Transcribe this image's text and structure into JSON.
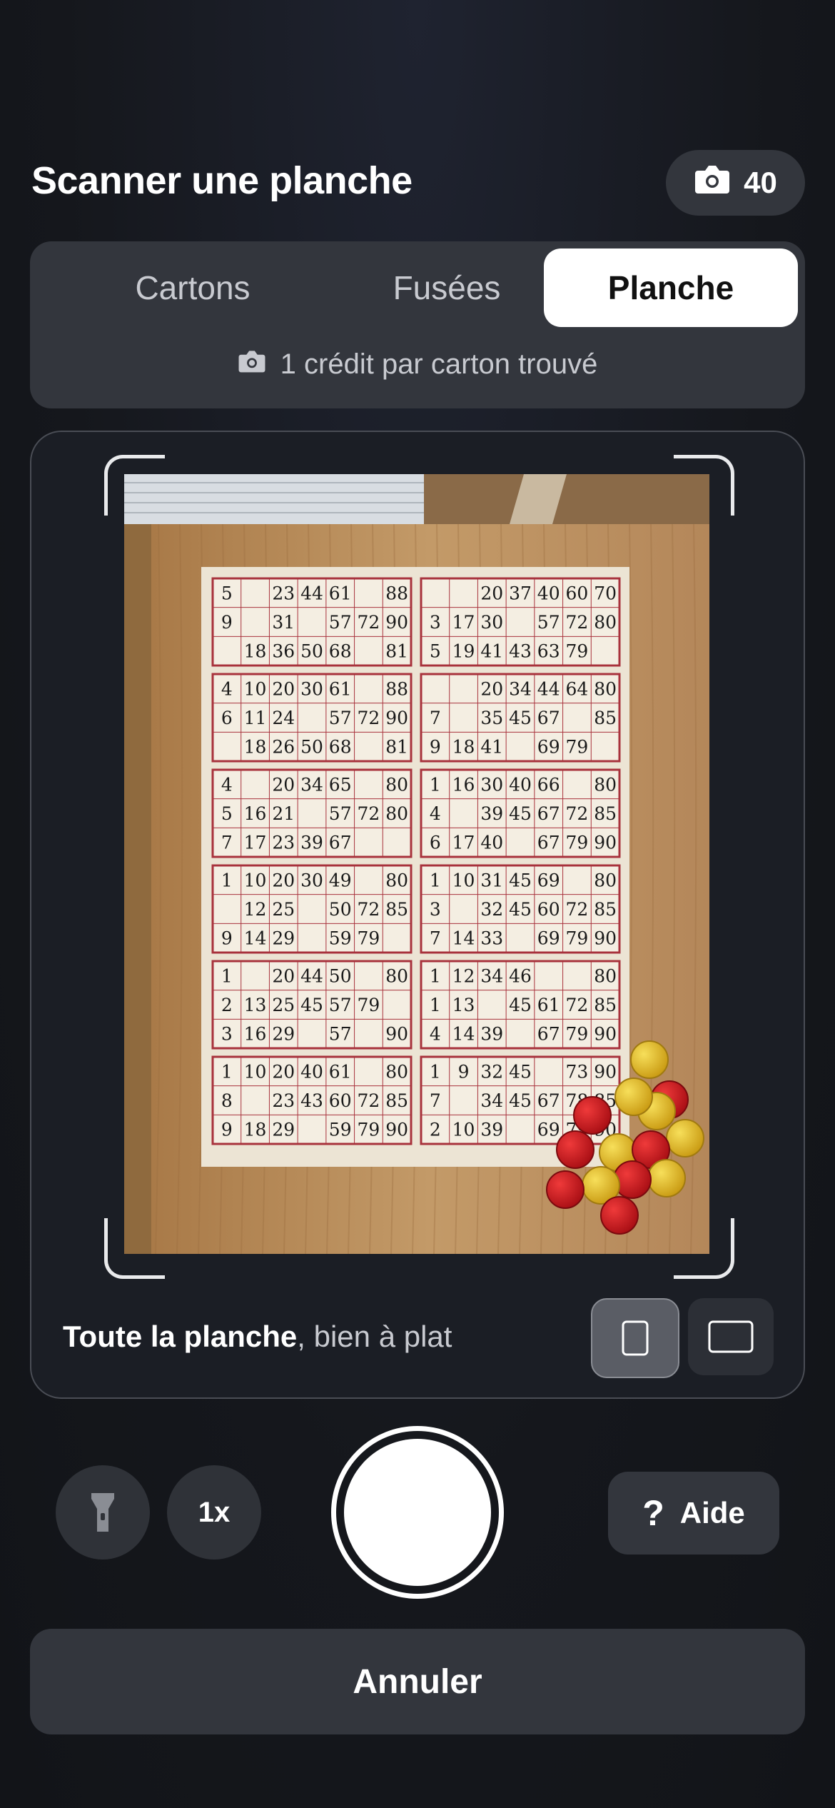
{
  "header": {
    "title": "Scanner une planche",
    "credits": "40"
  },
  "modes": {
    "tabs": [
      {
        "label": "Cartons",
        "active": false
      },
      {
        "label": "Fusées",
        "active": false
      },
      {
        "label": "Planche",
        "active": true
      }
    ],
    "hint": "1 crédit par carton trouvé"
  },
  "camera": {
    "instruction_bold": "Toute la planche",
    "instruction_rest": ", bien à plat",
    "orientation_selected": "portrait",
    "sheet_cards": [
      [
        [
          "5",
          "",
          "23",
          "44",
          "61",
          "",
          "88"
        ],
        [
          "9",
          "",
          "31",
          "",
          "57",
          "72",
          "90"
        ],
        [
          "",
          "18",
          "36",
          "50",
          "68",
          "",
          "81"
        ]
      ],
      [
        [
          "",
          "",
          "20",
          "37",
          "40",
          "60",
          "70"
        ],
        [
          "3",
          "17",
          "30",
          "",
          "57",
          "72",
          "80"
        ],
        [
          "5",
          "19",
          "41",
          "43",
          "63",
          "79",
          ""
        ]
      ],
      [
        [
          "4",
          "10",
          "20",
          "30",
          "61",
          "",
          "88"
        ],
        [
          "6",
          "11",
          "24",
          "",
          "57",
          "72",
          "90"
        ],
        [
          "",
          "18",
          "26",
          "50",
          "68",
          "",
          "81"
        ]
      ],
      [
        [
          "",
          "",
          "20",
          "34",
          "44",
          "64",
          "80"
        ],
        [
          "7",
          "",
          "35",
          "45",
          "67",
          "",
          "85"
        ],
        [
          "9",
          "18",
          "41",
          "",
          "69",
          "79",
          ""
        ]
      ],
      [
        [
          "4",
          "",
          "20",
          "34",
          "65",
          "",
          "80"
        ],
        [
          "5",
          "16",
          "21",
          "",
          "57",
          "72",
          "80"
        ],
        [
          "7",
          "17",
          "23",
          "39",
          "67",
          "",
          ""
        ]
      ],
      [
        [
          "1",
          "16",
          "30",
          "40",
          "66",
          "",
          "80"
        ],
        [
          "4",
          "",
          "39",
          "45",
          "67",
          "72",
          "85"
        ],
        [
          "6",
          "17",
          "40",
          "",
          "67",
          "79",
          "90"
        ]
      ],
      [
        [
          "1",
          "10",
          "20",
          "30",
          "49",
          "",
          "80"
        ],
        [
          "",
          "12",
          "25",
          "",
          "50",
          "72",
          "85"
        ],
        [
          "9",
          "14",
          "29",
          "",
          "59",
          "79",
          ""
        ]
      ],
      [
        [
          "1",
          "10",
          "31",
          "45",
          "69",
          "",
          "80"
        ],
        [
          "3",
          "",
          "32",
          "45",
          "60",
          "72",
          "85"
        ],
        [
          "7",
          "14",
          "33",
          "",
          "69",
          "79",
          "90"
        ]
      ],
      [
        [
          "1",
          "",
          "20",
          "44",
          "50",
          "",
          "80"
        ],
        [
          "2",
          "13",
          "25",
          "45",
          "57",
          "79",
          ""
        ],
        [
          "3",
          "16",
          "29",
          "",
          "57",
          "",
          "90"
        ]
      ],
      [
        [
          "1",
          "12",
          "34",
          "46",
          "",
          "",
          "80"
        ],
        [
          "1",
          "13",
          "",
          "45",
          "61",
          "72",
          "85"
        ],
        [
          "4",
          "14",
          "39",
          "",
          "67",
          "79",
          "90"
        ]
      ],
      [
        [
          "1",
          "10",
          "20",
          "40",
          "61",
          "",
          "80"
        ],
        [
          "8",
          "",
          "23",
          "43",
          "60",
          "72",
          "85"
        ],
        [
          "9",
          "18",
          "29",
          "",
          "59",
          "79",
          "90"
        ]
      ],
      [
        [
          "1",
          "9",
          "32",
          "45",
          "",
          "73",
          "90"
        ],
        [
          "7",
          "",
          "34",
          "45",
          "67",
          "78",
          "85"
        ],
        [
          "2",
          "10",
          "39",
          "",
          "69",
          "79",
          "90"
        ]
      ]
    ]
  },
  "controls": {
    "zoom": "1x",
    "help_label": "Aide",
    "cancel_label": "Annuler"
  },
  "colors": {
    "accent": "#ffffff",
    "card_border": "#a8323c",
    "token_red": "#c8161c",
    "token_yellow": "#e2b820"
  }
}
